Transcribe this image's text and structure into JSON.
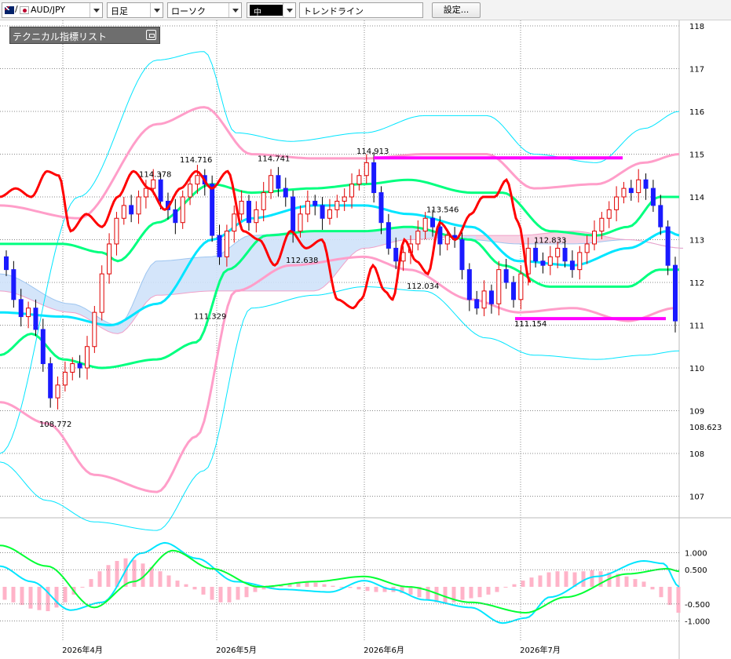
{
  "toolbar": {
    "symbol": "AUD/JPY",
    "period": "日足",
    "chart_style": "ローソク",
    "line_tool": "トレンドライン",
    "line_width_label": "中",
    "settings_label": "設定..."
  },
  "panel": {
    "title": "テクニカル指標リスト"
  },
  "colors": {
    "up_candle": "#e00000",
    "down_candle": "#1a1aff",
    "cloud_up": "#cfe2f9",
    "cloud_down": "#f7d3e4",
    "tenkan": "#00ff7f",
    "kijun": "#00b7ff",
    "chikou": "#ff0000",
    "bb_mid": "#00e5ff",
    "bb_1": "#ff9ec9",
    "bb_2": "#00ff00",
    "trendline": "#ff00ff",
    "macd": "#00e5ff",
    "signal": "#00ff33",
    "histogram": "#ffb3c8"
  },
  "chart_data": [
    {
      "type": "candlestick",
      "title": "",
      "ylim": [
        106.5,
        118.2
      ],
      "y_ticks": [
        "118",
        "117",
        "116",
        "115",
        "114",
        "113",
        "112",
        "111",
        "110",
        "109",
        "108",
        "107"
      ],
      "x_ticks": [
        "2026年4月",
        "2026年5月",
        "2026年6月",
        "2026年7月"
      ],
      "grid": true,
      "last_price_label": "108.623",
      "annotations": [
        {
          "label": "108.772",
          "value": 108.772
        },
        {
          "label": "114.378",
          "value": 114.378
        },
        {
          "label": "114.716",
          "value": 114.716
        },
        {
          "label": "111.329",
          "value": 111.329
        },
        {
          "label": "114.741",
          "value": 114.741
        },
        {
          "label": "112.638",
          "value": 112.638
        },
        {
          "label": "114.913",
          "value": 114.913
        },
        {
          "label": "113.546",
          "value": 113.546
        },
        {
          "label": "112.034",
          "value": 112.034
        },
        {
          "label": "112.833",
          "value": 112.833
        },
        {
          "label": "111.154",
          "value": 111.154
        }
      ],
      "trendlines": [
        {
          "name": "resistance",
          "y": 114.913
        },
        {
          "name": "support",
          "y": 111.154
        }
      ],
      "closes": [
        112.3,
        111.6,
        111.2,
        111.4,
        110.9,
        110.1,
        109.3,
        109.6,
        109.9,
        110.1,
        110.0,
        110.5,
        111.3,
        112.2,
        112.9,
        113.5,
        113.8,
        113.6,
        114.0,
        114.2,
        114.4,
        113.9,
        113.7,
        113.4,
        114.0,
        114.3,
        114.5,
        114.3,
        113.1,
        112.6,
        113.2,
        113.6,
        113.9,
        113.4,
        113.7,
        114.1,
        114.5,
        114.2,
        114.0,
        113.2,
        113.6,
        113.9,
        113.8,
        113.5,
        113.7,
        113.9,
        114.0,
        114.3,
        114.5,
        114.8,
        114.1,
        113.4,
        112.8,
        112.5,
        112.7,
        112.9,
        113.2,
        113.5,
        113.3,
        112.9,
        113.1,
        113.0,
        112.3,
        111.6,
        111.4,
        111.8,
        111.5,
        112.3,
        112.0,
        111.6,
        112.2,
        112.8,
        112.5,
        112.4,
        112.6,
        112.8,
        112.5,
        112.3,
        112.7,
        112.9,
        113.2,
        113.5,
        113.7,
        114.0,
        114.2,
        114.1,
        114.4,
        114.2,
        113.8,
        113.3,
        112.4,
        111.1
      ]
    },
    {
      "type": "macd",
      "ylim": [
        -1.0,
        1.0
      ],
      "y_ticks": [
        "1.000",
        "0.500",
        "-0.500",
        "-1.000"
      ],
      "histogram": [
        -0.25,
        -0.3,
        -0.35,
        -0.42,
        -0.45,
        -0.47,
        -0.4,
        -0.3,
        -0.15,
        0.0,
        0.15,
        0.3,
        0.42,
        0.5,
        0.55,
        0.52,
        0.45,
        0.38,
        0.3,
        0.22,
        0.12,
        0.05,
        -0.05,
        -0.15,
        -0.25,
        -0.3,
        -0.3,
        -0.25,
        -0.2,
        -0.1,
        -0.05,
        0.0,
        0.02,
        0.05,
        0.08,
        0.1,
        0.08,
        0.05,
        0.02,
        0.0,
        -0.02,
        -0.05,
        -0.08,
        -0.1,
        -0.1,
        -0.1,
        -0.12,
        -0.15,
        -0.2,
        -0.25,
        -0.3,
        -0.32,
        -0.3,
        -0.25,
        -0.22,
        -0.2,
        -0.15,
        -0.1,
        0.0,
        0.05,
        0.12,
        0.18,
        0.22,
        0.28,
        0.3,
        0.3,
        0.28,
        0.3,
        0.32,
        0.3,
        0.28,
        0.25,
        0.2,
        0.15,
        0.1,
        -0.05,
        -0.2,
        -0.35,
        -0.5
      ]
    }
  ]
}
